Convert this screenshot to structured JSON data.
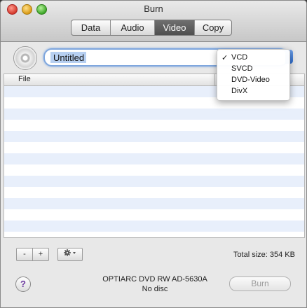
{
  "window": {
    "title": "Burn",
    "tabs": [
      {
        "label": "Data",
        "active": false
      },
      {
        "label": "Audio",
        "active": false
      },
      {
        "label": "Video",
        "active": true
      },
      {
        "label": "Copy",
        "active": false
      }
    ]
  },
  "disc_name": {
    "value": "Untitled"
  },
  "format_menu": {
    "items": [
      {
        "label": "VCD",
        "checked": true
      },
      {
        "label": "SVCD",
        "checked": false
      },
      {
        "label": "DVD-Video",
        "checked": false
      },
      {
        "label": "DivX",
        "checked": false
      }
    ],
    "checkmark": "✓"
  },
  "file_list": {
    "column_file": "File",
    "rows": []
  },
  "toolbar": {
    "remove_label": "-",
    "add_label": "+",
    "action_icon": "gear-icon"
  },
  "footer": {
    "total_size": "Total size: 354 KB",
    "help_label": "?",
    "drive_name": "OPTIARC DVD RW AD-5630A",
    "disc_status": "No disc",
    "burn_label": "Burn"
  },
  "colors": {
    "selected_tab": "#5a5a5a",
    "focus_ring": "#7fa7de",
    "alt_row": "#e8effb"
  }
}
